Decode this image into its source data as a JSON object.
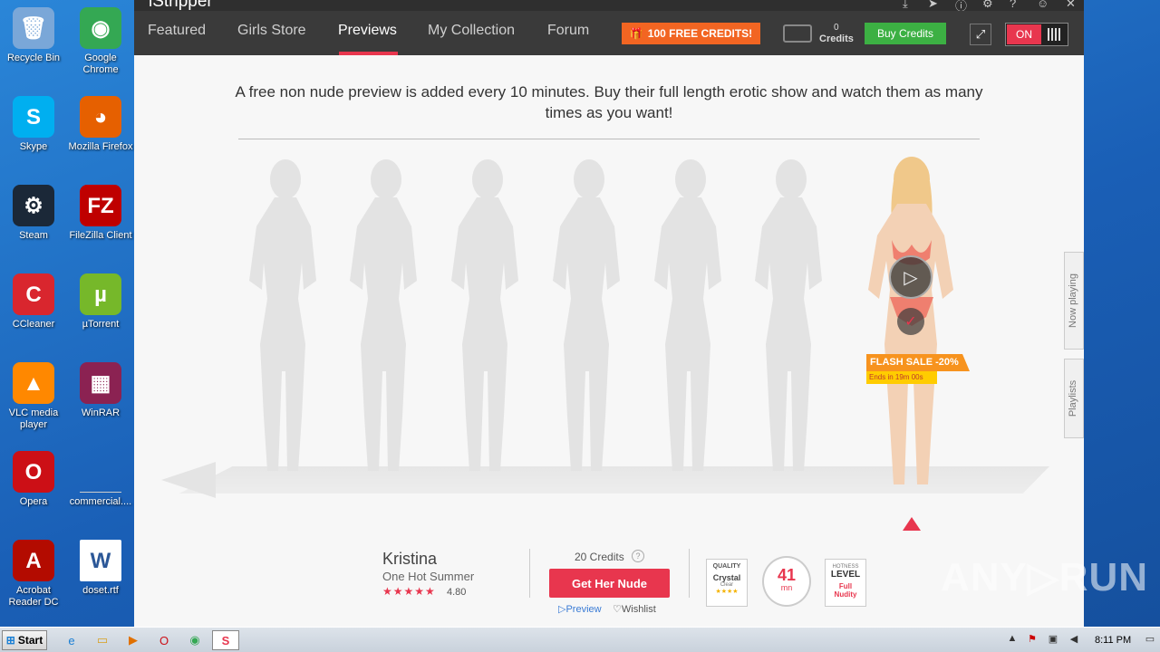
{
  "desktop": {
    "icons": [
      {
        "label": "Recycle Bin",
        "icon": "recycle-bin-icon",
        "color": "#7aa7d8",
        "glyph": "🗑"
      },
      {
        "label": "Google Chrome",
        "icon": "chrome-icon",
        "color": "#34a853",
        "glyph": "◉"
      },
      {
        "label": "Skype",
        "icon": "skype-icon",
        "color": "#00aff0",
        "glyph": "S"
      },
      {
        "label": "Mozilla Firefox",
        "icon": "firefox-icon",
        "color": "#e66000",
        "glyph": "◕"
      },
      {
        "label": "Steam",
        "icon": "steam-icon",
        "color": "#1b2838",
        "glyph": "⚙"
      },
      {
        "label": "FileZilla Client",
        "icon": "filezilla-icon",
        "color": "#bf0000",
        "glyph": "FZ"
      },
      {
        "label": "CCleaner",
        "icon": "ccleaner-icon",
        "color": "#d9262e",
        "glyph": "C"
      },
      {
        "label": "µTorrent",
        "icon": "utorrent-icon",
        "color": "#76b82a",
        "glyph": "µ"
      },
      {
        "label": "VLC media player",
        "icon": "vlc-icon",
        "color": "#ff8800",
        "glyph": "▲"
      },
      {
        "label": "WinRAR",
        "icon": "winrar-icon",
        "color": "#8b2252",
        "glyph": "▦"
      },
      {
        "label": "Opera",
        "icon": "opera-icon",
        "color": "#cc0f16",
        "glyph": "O"
      },
      {
        "label": "commercial....",
        "icon": "blank-file-icon",
        "color": "transparent",
        "glyph": ""
      },
      {
        "label": "Acrobat Reader DC",
        "icon": "acrobat-icon",
        "color": "#b30b00",
        "glyph": "A"
      },
      {
        "label": "doset.rtf",
        "icon": "word-doc-icon",
        "color": "#ffffff",
        "glyph": "W"
      }
    ]
  },
  "app": {
    "title": "iStripper",
    "nav": [
      "Featured",
      "Girls Store",
      "Previews",
      "My Collection",
      "Forum"
    ],
    "active_nav": "Previews",
    "free_credits_label": "100 FREE CREDITS!",
    "credits_count": "0",
    "credits_label": "Credits",
    "buy_credits_label": "Buy Credits",
    "toggle_label": "ON",
    "intro_text": "A free non nude preview is added every 10 minutes. Buy their full length erotic show and watch them as many times as you want!",
    "flash_sale": "FLASH SALE -20%",
    "flash_ends": "Ends in 19m 00s",
    "side_tabs": [
      "Now playing",
      "Playlists"
    ],
    "model": {
      "name": "Kristina",
      "show": "One Hot Summer",
      "stars": "★★★★★",
      "rating": "4.80",
      "price": "20 Credits",
      "cta": "Get Her Nude",
      "preview_label": "Preview",
      "wishlist_label": "Wishlist"
    },
    "badges": {
      "quality_title": "QUALITY",
      "quality_value": "Crystal",
      "quality_sub": "Clear",
      "quality_stars": "★★★★",
      "duration_value": "41",
      "duration_unit": "mn",
      "hotness_title": "HOTNESS",
      "hotness_level": "LEVEL",
      "hotness_value_1": "Full",
      "hotness_value_2": "Nudity"
    },
    "colors": {
      "accent": "#e8364e",
      "orange": "#f26522",
      "green": "#3cb043"
    }
  },
  "watermark": "ANY▷RUN",
  "taskbar": {
    "start_label": "Start",
    "time": "8:11 PM"
  }
}
